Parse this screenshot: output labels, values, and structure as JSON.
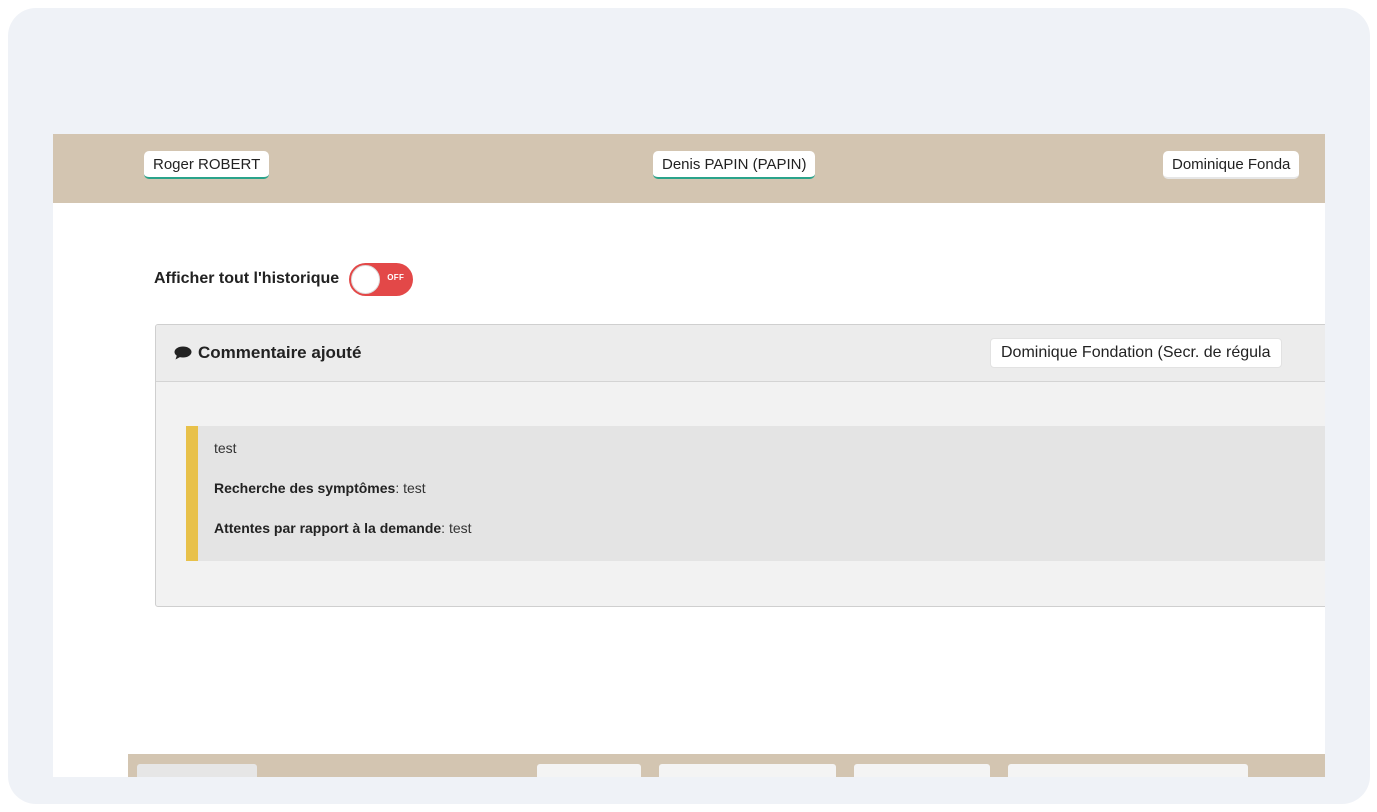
{
  "people": {
    "first": "Roger ROBERT",
    "second": "Denis PAPIN (PAPIN)",
    "third": "Dominique Fonda"
  },
  "history": {
    "label": "Afficher tout l'historique",
    "toggle_state": "OFF"
  },
  "event": {
    "title": "Commentaire ajouté",
    "author": "Dominique Fondation (Secr. de régula",
    "icon": "comment-icon",
    "body": {
      "text": "test",
      "symptoms_label": "Recherche des symptômes",
      "symptoms_value": ": test",
      "expectations_label": "Attentes par rapport à la demande",
      "expectations_value": ": test"
    }
  },
  "colors": {
    "band": "#d3c5b1",
    "toggle_off": "#e34848",
    "quote_accent": "#e8c14a",
    "chip_underline": "#2aa38a"
  }
}
